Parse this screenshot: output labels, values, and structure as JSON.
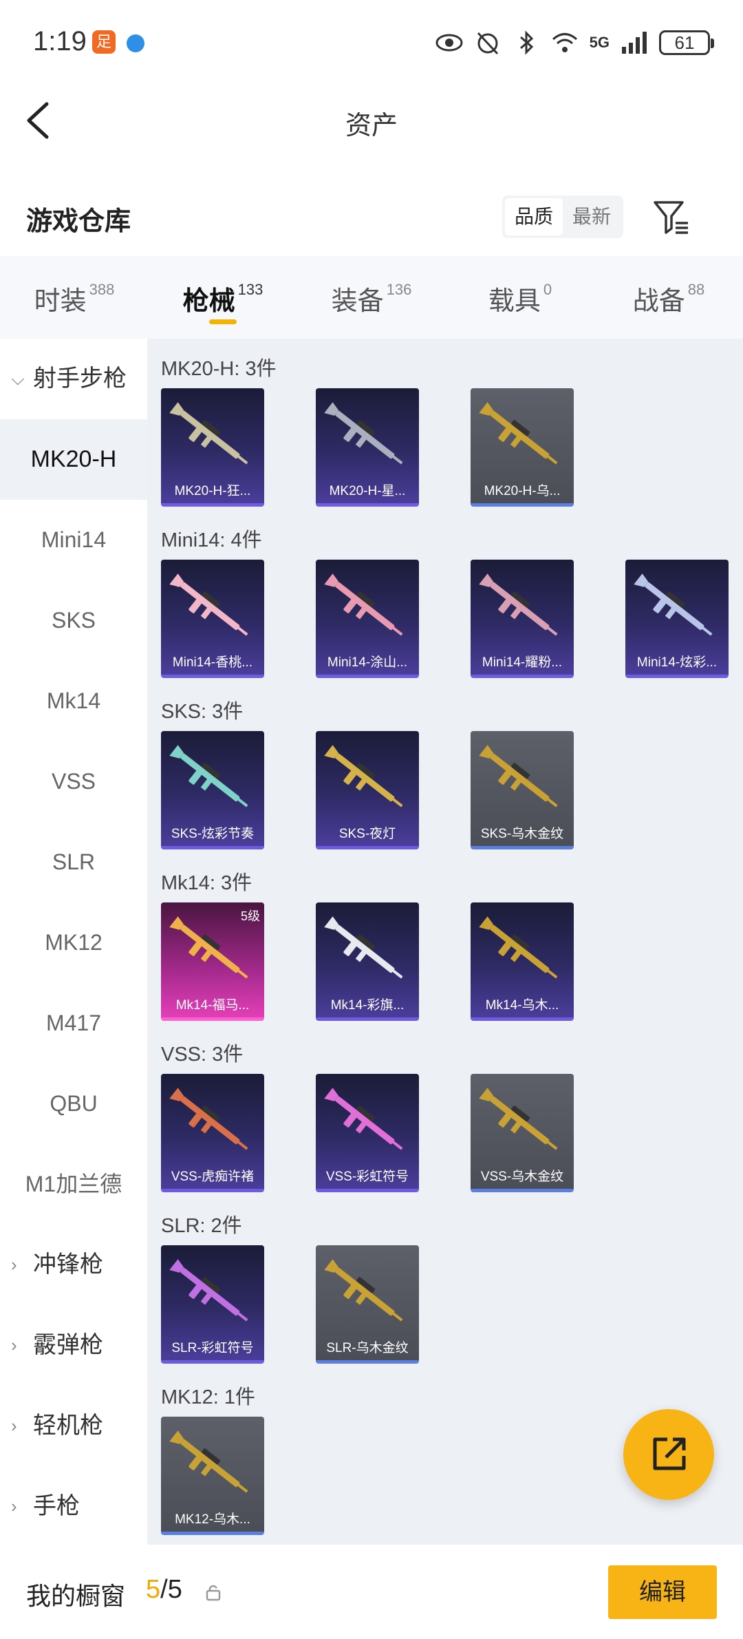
{
  "status": {
    "time": "1:19",
    "network": "5G",
    "battery": "61"
  },
  "header": {
    "title": "资产"
  },
  "section": {
    "title": "游戏仓库",
    "sort_options": [
      "品质",
      "最新"
    ],
    "active_sort": "品质"
  },
  "tabs": [
    {
      "label": "时装",
      "count": "388"
    },
    {
      "label": "枪械",
      "count": "133"
    },
    {
      "label": "装备",
      "count": "136"
    },
    {
      "label": "载具",
      "count": "0"
    },
    {
      "label": "战备",
      "count": "88"
    }
  ],
  "sidebar": {
    "group_open": "射手步枪",
    "items": [
      "MK20-H",
      "Mini14",
      "SKS",
      "Mk14",
      "VSS",
      "SLR",
      "MK12",
      "M417",
      "QBU",
      "M1加兰德"
    ],
    "groups_closed": [
      "冲锋枪",
      "霰弹枪",
      "轻机枪",
      "手枪"
    ]
  },
  "groups": [
    {
      "label": "MK20-H: 3件",
      "items": [
        {
          "name": "MK20-H-狂...",
          "style": "purple",
          "gun": "#c9c2a0"
        },
        {
          "name": "MK20-H-星...",
          "style": "purple",
          "gun": "#aab0bd"
        },
        {
          "name": "MK20-H-乌...",
          "style": "gray",
          "gun": "#c9a236"
        }
      ]
    },
    {
      "label": "Mini14: 4件",
      "items": [
        {
          "name": "Mini14-香桃...",
          "style": "purple",
          "gun": "#f2b8c8"
        },
        {
          "name": "Mini14-涂山...",
          "style": "purple",
          "gun": "#e89ab0"
        },
        {
          "name": "Mini14-耀粉...",
          "style": "purple",
          "gun": "#d9a0b4"
        },
        {
          "name": "Mini14-炫彩...",
          "style": "purple",
          "gun": "#b8c4e8"
        }
      ]
    },
    {
      "label": "SKS: 3件",
      "items": [
        {
          "name": "SKS-炫彩节奏",
          "style": "purple",
          "gun": "#7fd2c8"
        },
        {
          "name": "SKS-夜灯",
          "style": "purple",
          "gun": "#d6b24a"
        },
        {
          "name": "SKS-乌木金纹",
          "style": "gray",
          "gun": "#c9a236"
        }
      ]
    },
    {
      "label": "Mk14: 3件",
      "items": [
        {
          "name": "Mk14-福马...",
          "style": "pink",
          "gun": "#f0b04a",
          "level": "5级"
        },
        {
          "name": "Mk14-彩旗...",
          "style": "purple",
          "gun": "#e8e8f0"
        },
        {
          "name": "Mk14-乌木...",
          "style": "purple",
          "gun": "#c9a236"
        }
      ]
    },
    {
      "label": "VSS: 3件",
      "items": [
        {
          "name": "VSS-虎痴许褚",
          "style": "purple",
          "gun": "#d9704a"
        },
        {
          "name": "VSS-彩虹符号",
          "style": "purple",
          "gun": "#e070d8"
        },
        {
          "name": "VSS-乌木金纹",
          "style": "gray",
          "gun": "#c9a236"
        }
      ]
    },
    {
      "label": "SLR: 2件",
      "items": [
        {
          "name": "SLR-彩虹符号",
          "style": "purple",
          "gun": "#c070e0"
        },
        {
          "name": "SLR-乌木金纹",
          "style": "gray",
          "gun": "#c9a236"
        }
      ]
    },
    {
      "label": "MK12: 1件",
      "items": [
        {
          "name": "MK12-乌木...",
          "style": "gray",
          "gun": "#c9a236"
        }
      ]
    }
  ],
  "bottom": {
    "label": "我的橱窗",
    "current": "5",
    "total": "/5",
    "edit": "编辑"
  },
  "colors": {
    "accent": "#f8b415",
    "purple_bar": "#6f5be0",
    "gray_bar": "#5b7fe0"
  }
}
